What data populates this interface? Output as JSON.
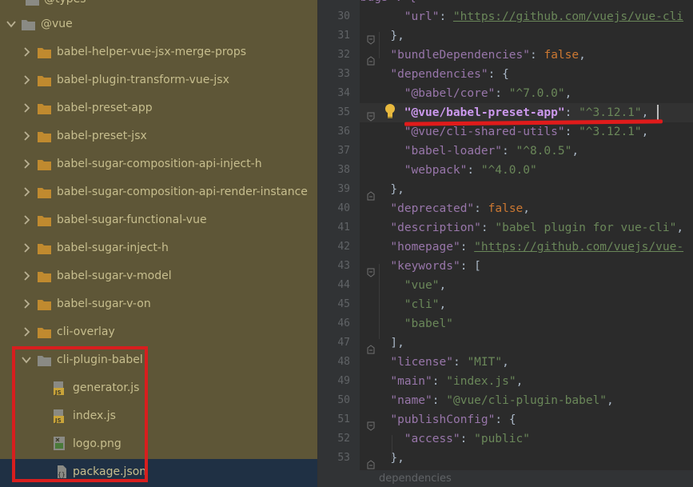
{
  "tree": {
    "top_partial": "@types",
    "root": "@vue",
    "folders": [
      "babel-helper-vue-jsx-merge-props",
      "babel-plugin-transform-vue-jsx",
      "babel-preset-app",
      "babel-preset-jsx",
      "babel-sugar-composition-api-inject-h",
      "babel-sugar-composition-api-render-instance",
      "babel-sugar-functional-vue",
      "babel-sugar-inject-h",
      "babel-sugar-v-model",
      "babel-sugar-v-on",
      "cli-overlay"
    ],
    "expanded_folder": "cli-plugin-babel",
    "files": [
      {
        "label": "generator.js",
        "icon": "js-file-icon"
      },
      {
        "label": "index.js",
        "icon": "js-file-icon"
      },
      {
        "label": "logo.png",
        "icon": "image-file-icon"
      },
      {
        "label": "package.json",
        "icon": "json-file-icon",
        "selected": true
      }
    ]
  },
  "editor": {
    "line_numbers": [
      "30",
      "31",
      "32",
      "33",
      "34",
      "35",
      "36",
      "37",
      "38",
      "39",
      "40",
      "41",
      "42",
      "43",
      "44",
      "45",
      "46",
      "47",
      "48",
      "49",
      "50",
      "51",
      "52",
      "53"
    ],
    "current_line": "35",
    "top_partial": "\"bugs\": {",
    "lines": {
      "l30": {
        "key": "\"url\"",
        "sep": ": ",
        "val": "\"https://github.com/vuejs/vue-cli"
      },
      "l31": {
        "text": "},"
      },
      "l32": {
        "key": "\"bundleDependencies\"",
        "sep": ": ",
        "val": "false",
        "end": ","
      },
      "l33": {
        "key": "\"dependencies\"",
        "sep": ": ",
        "end": "{"
      },
      "l34": {
        "key": "\"@babel/core\"",
        "sep": ": ",
        "val": "\"^7.0.0\"",
        "end": ","
      },
      "l35": {
        "key": "\"@vue/babel-preset-app\"",
        "sep": ": ",
        "val": "\"^3.12.1\"",
        "end": ","
      },
      "l36": {
        "key": "\"@vue/cli-shared-utils\"",
        "sep": ": ",
        "val": "\"^3.12.1\"",
        "end": ","
      },
      "l37": {
        "key": "\"babel-loader\"",
        "sep": ": ",
        "val": "\"^8.0.5\"",
        "end": ","
      },
      "l38": {
        "key": "\"webpack\"",
        "sep": ": ",
        "val": "\"^4.0.0\""
      },
      "l39": {
        "text": "},"
      },
      "l40": {
        "key": "\"deprecated\"",
        "sep": ": ",
        "val": "false",
        "end": ","
      },
      "l41": {
        "key": "\"description\"",
        "sep": ": ",
        "val": "\"babel plugin for vue-cli\"",
        "end": ","
      },
      "l42": {
        "key": "\"homepage\"",
        "sep": ": ",
        "val": "\"https://github.com/vuejs/vue-"
      },
      "l43": {
        "key": "\"keywords\"",
        "sep": ": ",
        "end": "["
      },
      "l44": {
        "val": "\"vue\"",
        "end": ","
      },
      "l45": {
        "val": "\"cli\"",
        "end": ","
      },
      "l46": {
        "val": "\"babel\""
      },
      "l47": {
        "text": "],"
      },
      "l48": {
        "key": "\"license\"",
        "sep": ": ",
        "val": "\"MIT\"",
        "end": ","
      },
      "l49": {
        "key": "\"main\"",
        "sep": ": ",
        "val": "\"index.js\"",
        "end": ","
      },
      "l50": {
        "key": "\"name\"",
        "sep": ": ",
        "val": "\"@vue/cli-plugin-babel\"",
        "end": ","
      },
      "l51": {
        "key": "\"publishConfig\"",
        "sep": ": ",
        "end": "{"
      },
      "l52": {
        "key": "\"access\"",
        "sep": ": ",
        "val": "\"public\""
      },
      "l53": {
        "text": "},"
      }
    }
  },
  "status": {
    "breadcrumb": "dependencies"
  },
  "colors": {
    "tree_bg": "#5e5637",
    "tree_text": "#c7be8e",
    "editor_bg": "#2b2b2b",
    "key": "#9876aa",
    "string": "#6a8759",
    "keyword": "#cc7832",
    "annotation_red": "#d81e1e"
  }
}
